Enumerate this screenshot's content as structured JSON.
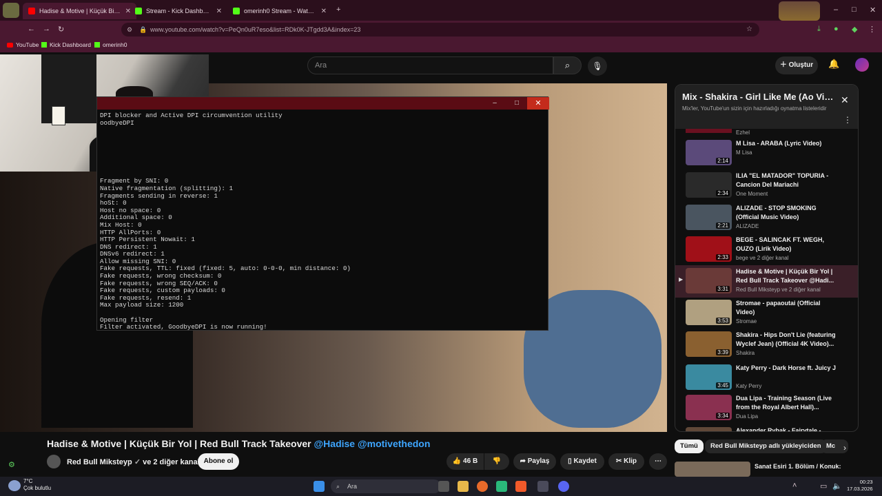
{
  "browser": {
    "tabs": [
      {
        "label": "Hadise & Motive | Küçük Bir Yol",
        "active": true,
        "favicon_color": "#ff0000"
      },
      {
        "label": "Stream - Kick Dashboard",
        "active": false,
        "favicon_color": "#53fc18"
      },
      {
        "label": "omerinh0 Stream - Watch Live",
        "active": false,
        "favicon_color": "#53fc18"
      }
    ],
    "new_tab": "+",
    "url": "www.youtube.com/watch?v=PeQn0uR7eso&list=RDk0K-JTgdd3A&index=23",
    "bookmarks": [
      "YouTube",
      "Kick Dashboard",
      "omerinh0"
    ]
  },
  "youtube": {
    "search_placeholder": "Ara",
    "create_label": "Oluştur"
  },
  "cmd": {
    "text": "DPI blocker and Active DPI circumvention utility\noodbyeDPI\n\n\n\n\n\n\n\nFragment by SNI: 0\nNative fragmentation (splitting): 1\nFragments sending in reverse: 1\nhoSt: 0\nHost no space: 0\nAdditional space: 0\nMix Host: 0\nHTTP AllPorts: 0\nHTTP Persistent Nowait: 1\nDNS redirect: 1\nDNSv6 redirect: 1\nAllow missing SNI: 0\nFake requests, TTL: fixed (fixed: 5, auto: 0-0-0, min distance: 0)\nFake requests, wrong checksum: 0\nFake requests, wrong SEQ/ACK: 0\nFake requests, custom payloads: 0\nFake requests, resend: 1\nMax payload size: 1200\n\nOpening filter\nFilter activated, GoodbyeDPI is now running!"
  },
  "video": {
    "title": "Hadise & Motive | Küçük Bir Yol | Red Bull Track Takeover",
    "tags": "@Hadise @motivethedon",
    "channel": "Red Bull Miksteyp",
    "channel_suffix": "ve 2 diğer kanal",
    "subscribe_label": "Abone ol",
    "likes": "46 B",
    "share_label": "Paylaş",
    "save_label": "Kaydet",
    "clip_label": "Klip"
  },
  "mix": {
    "title": "Mix - Shakira - Girl Like Me (Ao Viv...",
    "subtitle": "Mix'ler, YouTube'un sizin için hazırladığı oynatma listeleridir",
    "partial_channel": "Ezhel",
    "items": [
      {
        "title": "M Lisa - ARABA (Lyric Video)",
        "channel": "M Lisa",
        "duration": "2:14",
        "color": "#5b4a7a",
        "current": false
      },
      {
        "title": "ILIA \"EL MATADOR\" TOPURIA - Cancion Del Mariachi",
        "channel": "One Moment",
        "duration": "2:34",
        "color": "#2a2a2a",
        "current": false
      },
      {
        "title": "ALIZADE - STOP SMOKING (Official Music Video)",
        "channel": "ALIZADE",
        "duration": "2:21",
        "color": "#4a5560",
        "current": false
      },
      {
        "title": "BEGE - SALINCAK FT. WEGH, OUZO (Lirik Video)",
        "channel": "bege ve 2 diğer kanal",
        "duration": "2:33",
        "color": "#a01018",
        "current": false
      },
      {
        "title": "Hadise & Motive | Küçük Bir Yol | Red Bull Track Takeover @Hadi...",
        "channel": "Red Bull Miksteyp ve 2 diğer kanal",
        "duration": "3:31",
        "color": "#6a3a38",
        "current": true
      },
      {
        "title": "Stromae - papaoutai (Official Video)",
        "channel": "Stromae",
        "duration": "3:53",
        "color": "#b0a080",
        "current": false
      },
      {
        "title": "Shakira - Hips Don't Lie (featuring Wyclef Jean) (Official 4K Video)...",
        "channel": "Shakira",
        "duration": "3:39",
        "color": "#8a6030",
        "current": false
      },
      {
        "title": "Katy Perry - Dark Horse ft. Juicy J",
        "channel": "Katy Perry",
        "duration": "3:45",
        "color": "#3a8aa0",
        "current": false
      },
      {
        "title": "Dua Lipa - Training Season (Live from the Royal Albert Hall)...",
        "channel": "Dua Lipa",
        "duration": "3:34",
        "color": "#8a3050",
        "current": false
      },
      {
        "title": "Alexander Rybak - Fairytale -",
        "channel": "",
        "duration": "",
        "color": "#604838",
        "current": false
      }
    ],
    "chips": [
      "Tümü",
      "Red Bull Miksteyp adlı yükleyiciden",
      "Mc"
    ],
    "next_title": "Sanat Esiri 1. Bölüm / Konuk:"
  },
  "taskbar": {
    "temp": "7°C",
    "weather": "Çok bulutlu",
    "search": "Ara",
    "time": "00:23",
    "date": "17.03.2026"
  }
}
